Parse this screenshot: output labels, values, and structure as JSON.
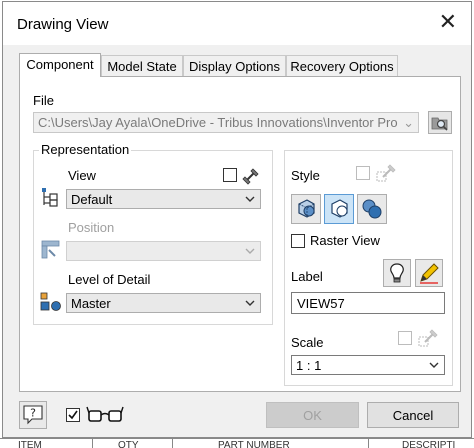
{
  "dialog": {
    "title": "Drawing View"
  },
  "tabs": [
    {
      "label": "Component"
    },
    {
      "label": "Model State"
    },
    {
      "label": "Display Options"
    },
    {
      "label": "Recovery Options"
    }
  ],
  "file": {
    "label": "File",
    "path": "C:\\Users\\Jay Ayala\\OneDrive - Tribus Innovations\\Inventor Pro"
  },
  "representation": {
    "group_label": "Representation",
    "view": {
      "label": "View",
      "value": "Default"
    },
    "position": {
      "label": "Position",
      "value": ""
    },
    "level_of_detail": {
      "label": "Level of Detail",
      "value": "Master"
    }
  },
  "style": {
    "label": "Style",
    "raster_view_label": "Raster View"
  },
  "view_label": {
    "label": "Label",
    "value": "VIEW57"
  },
  "scale": {
    "label": "Scale",
    "value": "1 : 1"
  },
  "footer": {
    "ok_label": "OK",
    "cancel_label": "Cancel"
  },
  "background_table": {
    "headers": [
      "ITEM",
      "QTY",
      "PART NUMBER",
      "DESCRIPTI"
    ]
  },
  "colors": {
    "accent": "#5b9bd5",
    "pressed_fill": "#cce4f7",
    "dialog_bg": "#f0f0f0"
  }
}
